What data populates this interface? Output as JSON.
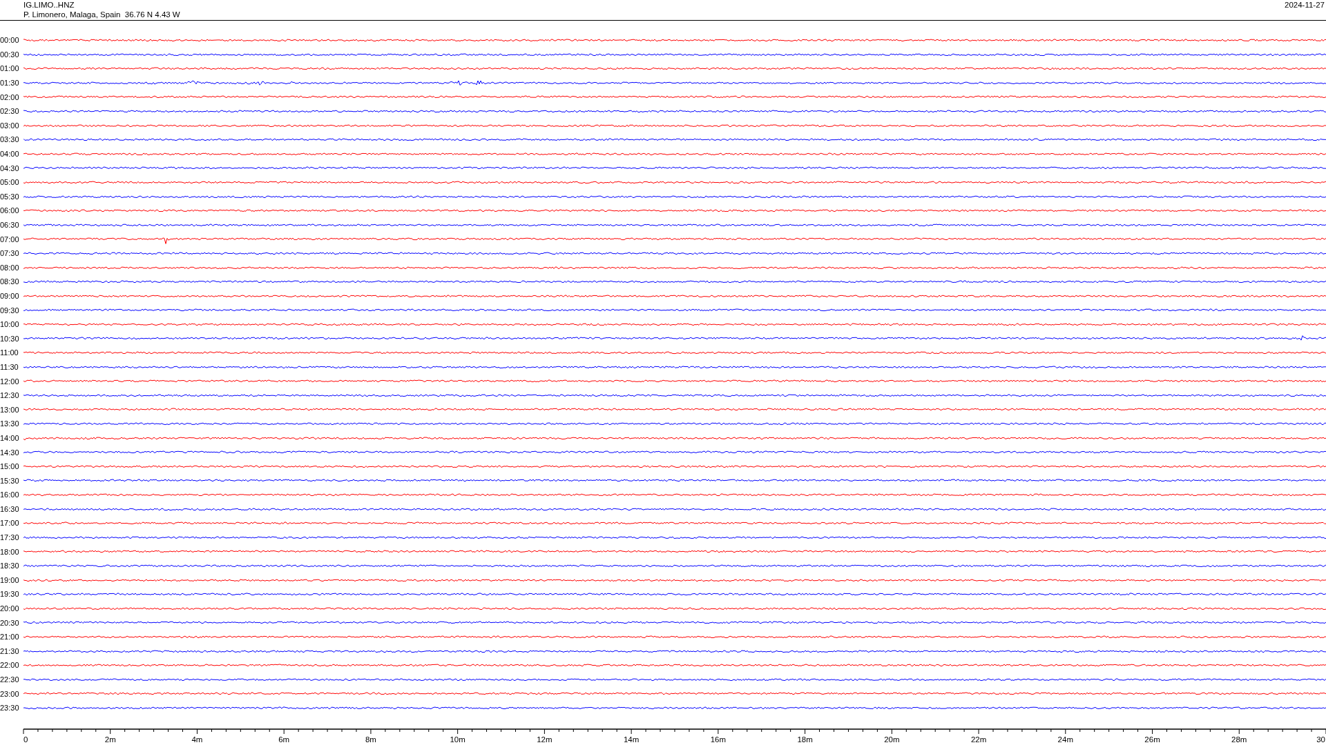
{
  "header": {
    "station": "IG.LIMO..HNZ",
    "location": "P. Limonero, Malaga, Spain  36.76 N 4.43 W",
    "date": "2024-11-27"
  },
  "rows": [
    {
      "label": "00:00",
      "color": "#ff0000"
    },
    {
      "label": "00:30",
      "color": "#0000ff"
    },
    {
      "label": "01:00",
      "color": "#ff0000"
    },
    {
      "label": "01:30",
      "color": "#0000ff"
    },
    {
      "label": "02:00",
      "color": "#ff0000"
    },
    {
      "label": "02:30",
      "color": "#0000ff"
    },
    {
      "label": "03:00",
      "color": "#ff0000"
    },
    {
      "label": "03:30",
      "color": "#0000ff"
    },
    {
      "label": "04:00",
      "color": "#ff0000"
    },
    {
      "label": "04:30",
      "color": "#0000ff"
    },
    {
      "label": "05:00",
      "color": "#ff0000"
    },
    {
      "label": "05:30",
      "color": "#0000ff"
    },
    {
      "label": "06:00",
      "color": "#ff0000"
    },
    {
      "label": "06:30",
      "color": "#0000ff"
    },
    {
      "label": "07:00",
      "color": "#ff0000"
    },
    {
      "label": "07:30",
      "color": "#0000ff"
    },
    {
      "label": "08:00",
      "color": "#ff0000"
    },
    {
      "label": "08:30",
      "color": "#0000ff"
    },
    {
      "label": "09:00",
      "color": "#ff0000"
    },
    {
      "label": "09:30",
      "color": "#0000ff"
    },
    {
      "label": "10:00",
      "color": "#ff0000"
    },
    {
      "label": "10:30",
      "color": "#0000ff"
    },
    {
      "label": "11:00",
      "color": "#ff0000"
    },
    {
      "label": "11:30",
      "color": "#0000ff"
    },
    {
      "label": "12:00",
      "color": "#ff0000"
    },
    {
      "label": "12:30",
      "color": "#0000ff"
    },
    {
      "label": "13:00",
      "color": "#ff0000"
    },
    {
      "label": "13:30",
      "color": "#0000ff"
    },
    {
      "label": "14:00",
      "color": "#ff0000"
    },
    {
      "label": "14:30",
      "color": "#0000ff"
    },
    {
      "label": "15:00",
      "color": "#ff0000"
    },
    {
      "label": "15:30",
      "color": "#0000ff"
    },
    {
      "label": "16:00",
      "color": "#ff0000"
    },
    {
      "label": "16:30",
      "color": "#0000ff"
    },
    {
      "label": "17:00",
      "color": "#ff0000"
    },
    {
      "label": "17:30",
      "color": "#0000ff"
    },
    {
      "label": "18:00",
      "color": "#ff0000"
    },
    {
      "label": "18:30",
      "color": "#0000ff"
    },
    {
      "label": "19:00",
      "color": "#ff0000"
    },
    {
      "label": "19:30",
      "color": "#0000ff"
    },
    {
      "label": "20:00",
      "color": "#ff0000"
    },
    {
      "label": "20:30",
      "color": "#0000ff"
    },
    {
      "label": "21:00",
      "color": "#ff0000"
    },
    {
      "label": "21:30",
      "color": "#0000ff"
    },
    {
      "label": "22:00",
      "color": "#ff0000"
    },
    {
      "label": "22:30",
      "color": "#0000ff"
    },
    {
      "label": "23:00",
      "color": "#ff0000"
    },
    {
      "label": "23:30",
      "color": "#0000ff"
    }
  ],
  "axis": {
    "ticks": [
      "0",
      "2m",
      "4m",
      "6m",
      "8m",
      "10m",
      "12m",
      "14m",
      "16m",
      "18m",
      "20m",
      "22m",
      "24m",
      "26m",
      "28m",
      "30"
    ]
  }
}
